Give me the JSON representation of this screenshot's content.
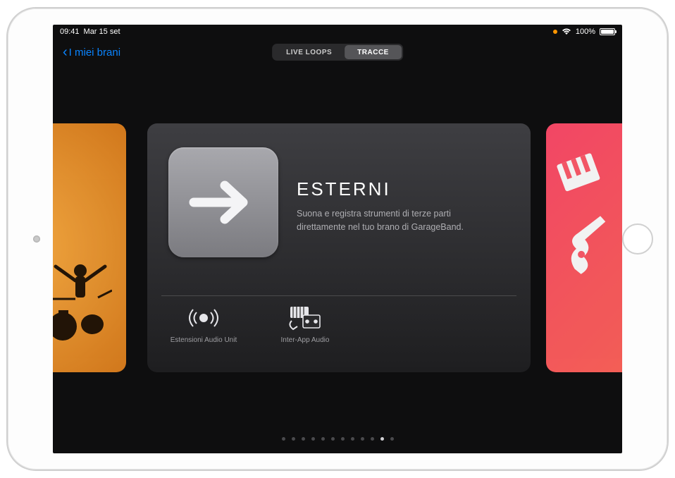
{
  "status_bar": {
    "time": "09:41",
    "date": "Mar 15 set",
    "battery_pct": "100%"
  },
  "nav": {
    "back_label": "I miei brani",
    "segments": [
      "LIVE LOOPS",
      "TRACCE"
    ],
    "active_segment": 1
  },
  "main_card": {
    "title": "ESTERNI",
    "description": "Suona e registra strumenti di terze parti direttamente nel tuo brano di GarageBand.",
    "sub_items": [
      {
        "label": "Estensioni Audio Unit",
        "icon": "audio-unit-icon"
      },
      {
        "label": "Inter-App Audio",
        "icon": "inter-app-audio-icon"
      }
    ]
  },
  "pagination": {
    "total": 12,
    "active_index": 10
  }
}
